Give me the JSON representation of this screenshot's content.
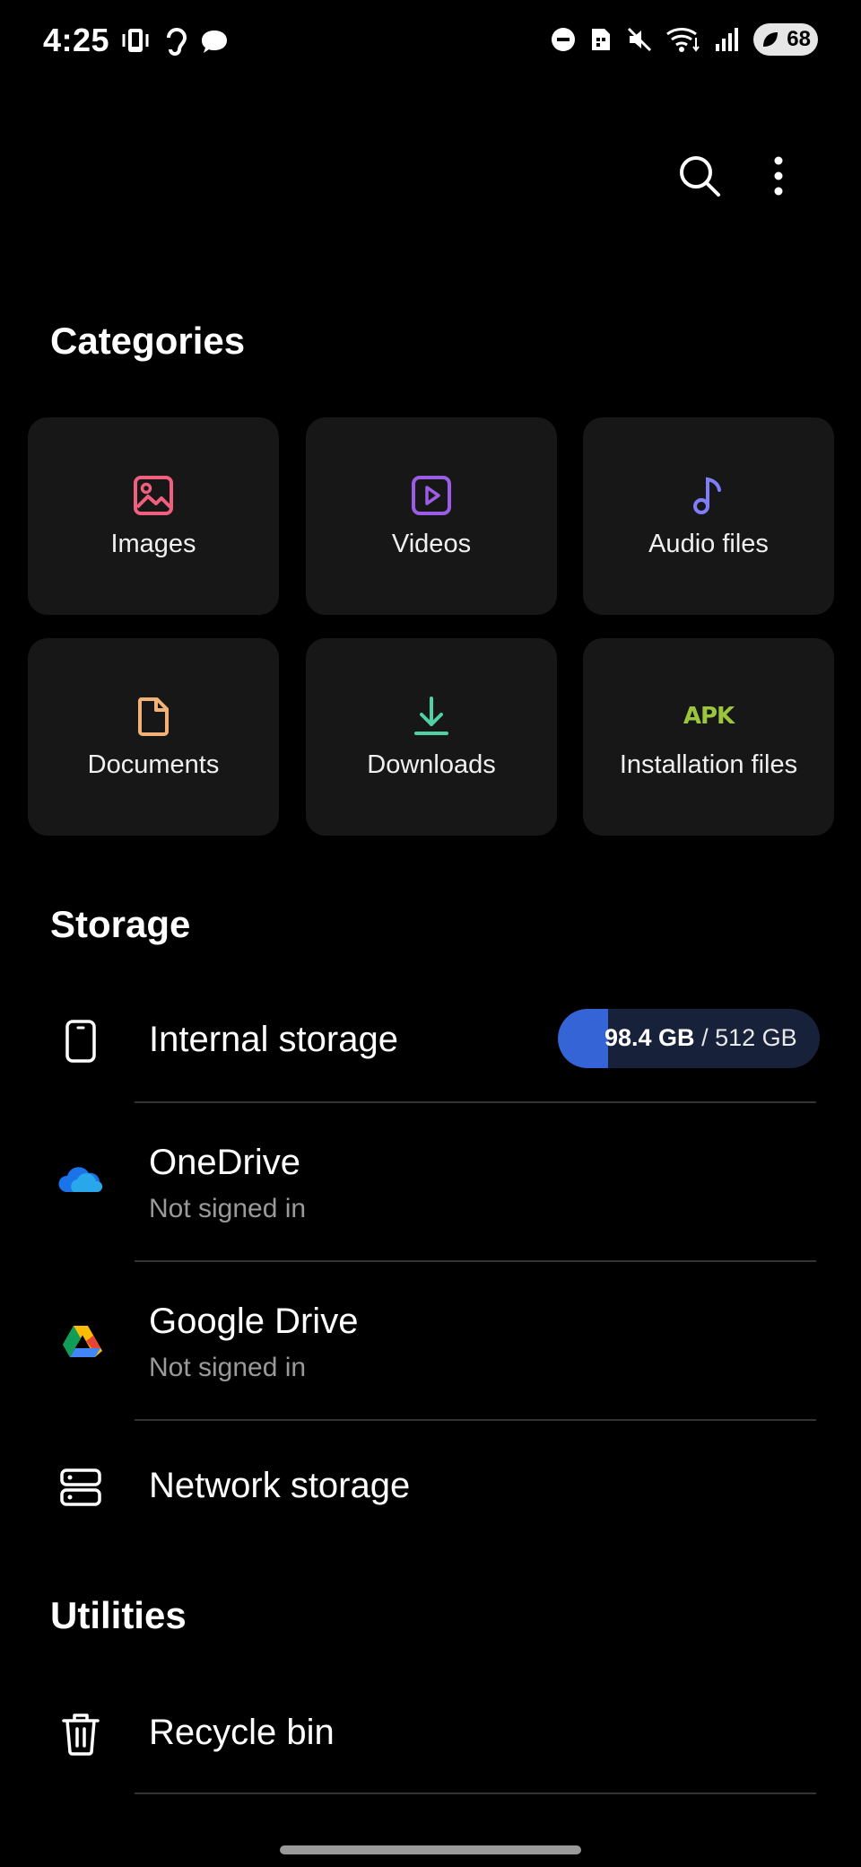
{
  "status_bar": {
    "time": "4:25",
    "battery_level": "68"
  },
  "toolbar": {
    "search_icon": "search-icon",
    "more_icon": "more-vert-icon"
  },
  "categories": {
    "title": "Categories",
    "items": [
      {
        "label": "Images",
        "icon": "image-icon",
        "color": "#ef5f7e"
      },
      {
        "label": "Videos",
        "icon": "video-icon",
        "color": "#9b5de5"
      },
      {
        "label": "Audio files",
        "icon": "music-note-icon",
        "color": "#7f7df7"
      },
      {
        "label": "Documents",
        "icon": "document-icon",
        "color": "#f2b277"
      },
      {
        "label": "Downloads",
        "icon": "download-icon",
        "color": "#4fd1a5"
      },
      {
        "label": "Installation files",
        "icon": "apk-icon",
        "icon_text": "APK",
        "color": "#9bc53d"
      }
    ]
  },
  "storage": {
    "title": "Storage",
    "internal": {
      "label": "Internal storage",
      "used": "98.4 GB",
      "separator": " / ",
      "total": "512 GB",
      "used_fraction": 0.192
    },
    "items": [
      {
        "label": "OneDrive",
        "status": "Not signed in"
      },
      {
        "label": "Google Drive",
        "status": "Not signed in"
      },
      {
        "label": "Network storage"
      }
    ]
  },
  "utilities": {
    "title": "Utilities",
    "items": [
      {
        "label": "Recycle bin"
      }
    ]
  }
}
